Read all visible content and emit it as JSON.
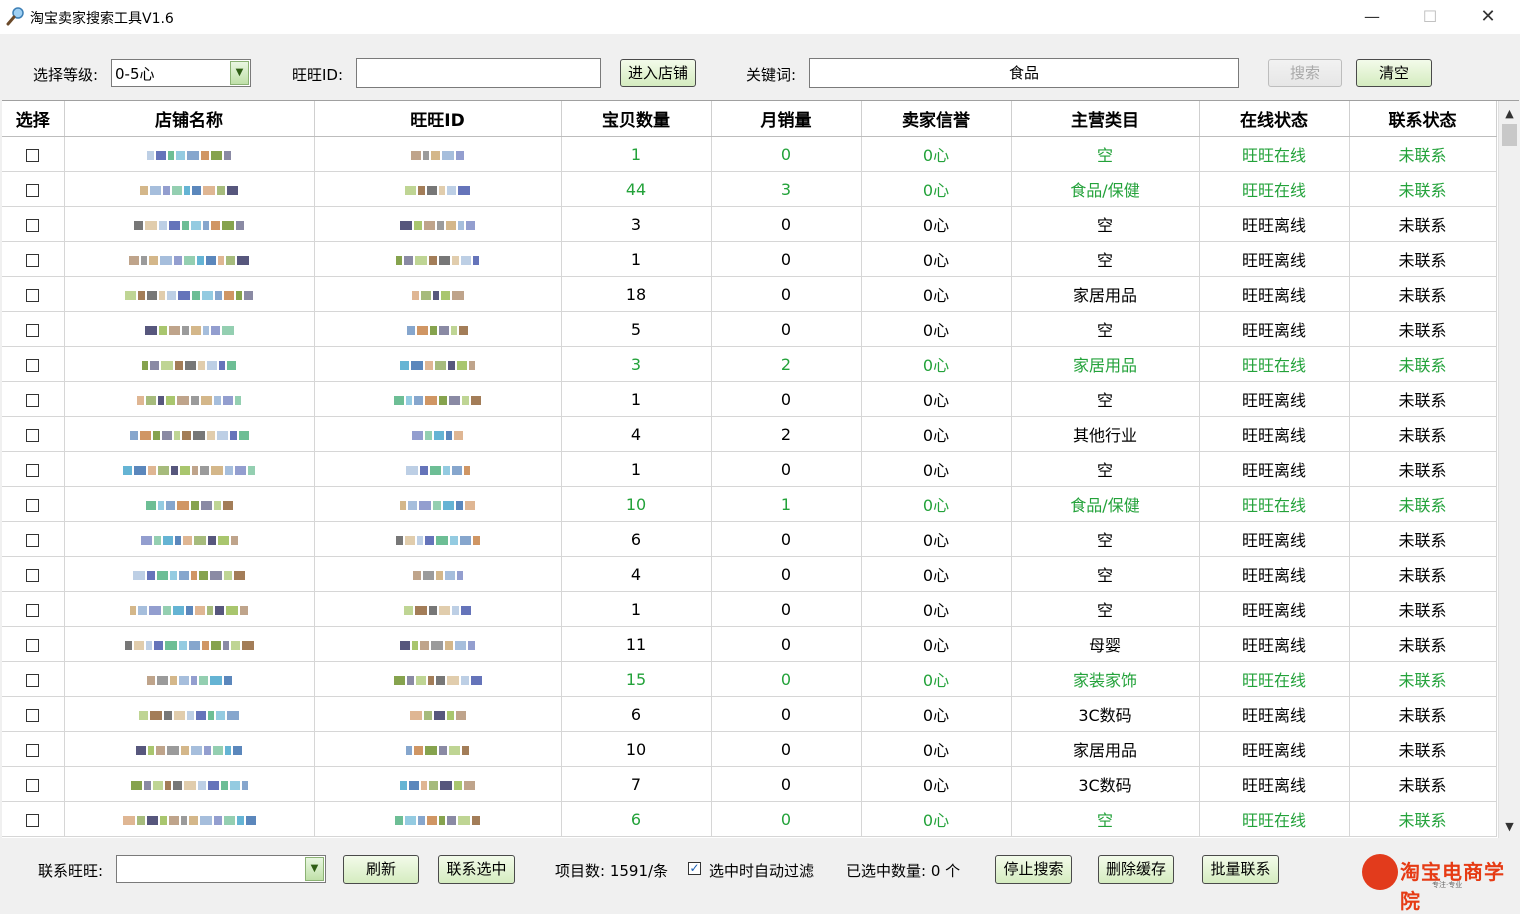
{
  "window": {
    "title": "淘宝卖家搜索工具V1.6",
    "min_glyph": "—",
    "max_glyph": "☐",
    "close_glyph": "✕"
  },
  "toolbar": {
    "level_label": "选择等级:",
    "level_value": "0-5心",
    "wangwang_label": "旺旺ID:",
    "wangwang_value": "",
    "enter_shop_label": "进入店铺",
    "keyword_label": "关键词:",
    "keyword_value": "食品",
    "search_label": "搜索",
    "clear_label": "清空"
  },
  "table": {
    "columns": [
      "选择",
      "店铺名称",
      "旺旺ID",
      "宝贝数量",
      "月销量",
      "卖家信誉",
      "主营类目",
      "在线状态",
      "联系状态"
    ],
    "rows": [
      {
        "count": "1",
        "sales": "0",
        "rep": "0心",
        "cat": "空",
        "online": "旺旺在线",
        "contact": "未联系",
        "is_online": true
      },
      {
        "count": "44",
        "sales": "3",
        "rep": "0心",
        "cat": "食品/保健",
        "online": "旺旺在线",
        "contact": "未联系",
        "is_online": true
      },
      {
        "count": "3",
        "sales": "0",
        "rep": "0心",
        "cat": "空",
        "online": "旺旺离线",
        "contact": "未联系",
        "is_online": false
      },
      {
        "count": "1",
        "sales": "0",
        "rep": "0心",
        "cat": "空",
        "online": "旺旺离线",
        "contact": "未联系",
        "is_online": false
      },
      {
        "count": "18",
        "sales": "0",
        "rep": "0心",
        "cat": "家居用品",
        "online": "旺旺离线",
        "contact": "未联系",
        "is_online": false
      },
      {
        "count": "5",
        "sales": "0",
        "rep": "0心",
        "cat": "空",
        "online": "旺旺离线",
        "contact": "未联系",
        "is_online": false
      },
      {
        "count": "3",
        "sales": "2",
        "rep": "0心",
        "cat": "家居用品",
        "online": "旺旺在线",
        "contact": "未联系",
        "is_online": true
      },
      {
        "count": "1",
        "sales": "0",
        "rep": "0心",
        "cat": "空",
        "online": "旺旺离线",
        "contact": "未联系",
        "is_online": false
      },
      {
        "count": "4",
        "sales": "2",
        "rep": "0心",
        "cat": "其他行业",
        "online": "旺旺离线",
        "contact": "未联系",
        "is_online": false
      },
      {
        "count": "1",
        "sales": "0",
        "rep": "0心",
        "cat": "空",
        "online": "旺旺离线",
        "contact": "未联系",
        "is_online": false
      },
      {
        "count": "10",
        "sales": "1",
        "rep": "0心",
        "cat": "食品/保健",
        "online": "旺旺在线",
        "contact": "未联系",
        "is_online": true
      },
      {
        "count": "6",
        "sales": "0",
        "rep": "0心",
        "cat": "空",
        "online": "旺旺离线",
        "contact": "未联系",
        "is_online": false
      },
      {
        "count": "4",
        "sales": "0",
        "rep": "0心",
        "cat": "空",
        "online": "旺旺离线",
        "contact": "未联系",
        "is_online": false
      },
      {
        "count": "1",
        "sales": "0",
        "rep": "0心",
        "cat": "空",
        "online": "旺旺离线",
        "contact": "未联系",
        "is_online": false
      },
      {
        "count": "11",
        "sales": "0",
        "rep": "0心",
        "cat": "母婴",
        "online": "旺旺离线",
        "contact": "未联系",
        "is_online": false
      },
      {
        "count": "15",
        "sales": "0",
        "rep": "0心",
        "cat": "家装家饰",
        "online": "旺旺在线",
        "contact": "未联系",
        "is_online": true
      },
      {
        "count": "6",
        "sales": "0",
        "rep": "0心",
        "cat": "3C数码",
        "online": "旺旺离线",
        "contact": "未联系",
        "is_online": false
      },
      {
        "count": "10",
        "sales": "0",
        "rep": "0心",
        "cat": "家居用品",
        "online": "旺旺离线",
        "contact": "未联系",
        "is_online": false
      },
      {
        "count": "7",
        "sales": "0",
        "rep": "0心",
        "cat": "3C数码",
        "online": "旺旺离线",
        "contact": "未联系",
        "is_online": false
      },
      {
        "count": "6",
        "sales": "0",
        "rep": "0心",
        "cat": "空",
        "online": "旺旺在线",
        "contact": "未联系",
        "is_online": true
      }
    ]
  },
  "bottom": {
    "contact_label": "联系旺旺:",
    "contact_value": "",
    "refresh_label": "刷新",
    "contact_selected_label": "联系选中",
    "item_count_text": "项目数: 1591/条",
    "auto_filter_label": "选中时自动过滤",
    "auto_filter_checked": true,
    "selected_count_text": "已选中数量: 0 个",
    "stop_search_label": "停止搜索",
    "delete_cache_label": "删除缓存",
    "batch_contact_label": "批量联系"
  },
  "watermark": {
    "text": "淘宝电商学院",
    "sub": "专注·专业"
  },
  "colors": {
    "online_green": "#23a23a",
    "button_green": "#d5ecc0",
    "watermark_red": "#e63b14"
  }
}
